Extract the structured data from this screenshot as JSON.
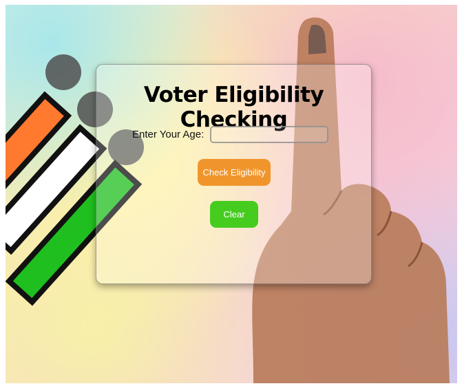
{
  "form": {
    "title": "Voter Eligibility Checking",
    "age_label": "Enter Your Age:",
    "age_value": "",
    "age_placeholder": "",
    "check_button_label": "Check Eligibility",
    "clear_button_label": "Clear"
  },
  "colors": {
    "check_button": "#f0952b",
    "clear_button": "#45cc1f"
  }
}
